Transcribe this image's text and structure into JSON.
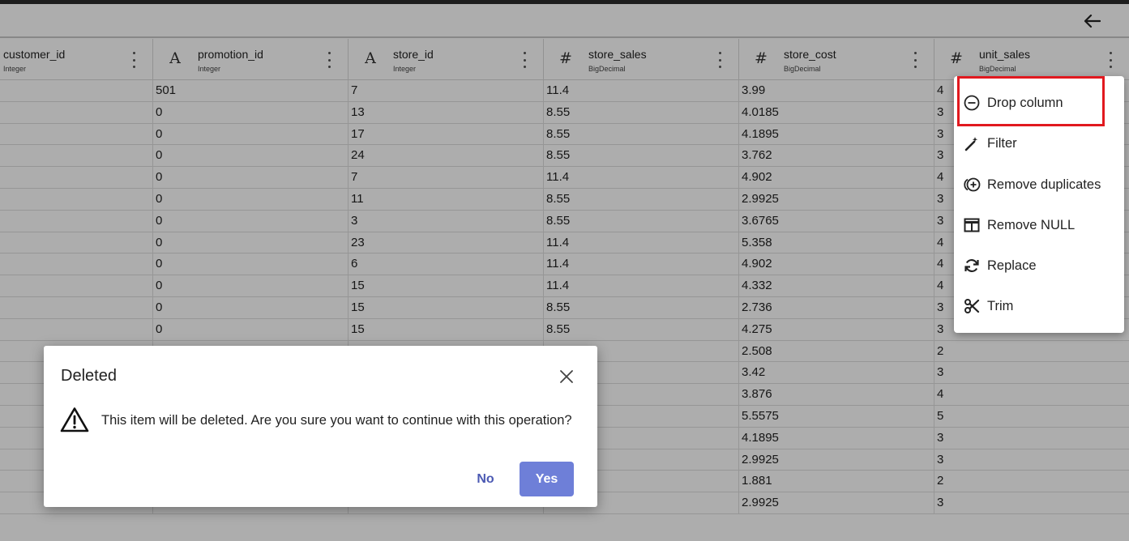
{
  "columns": [
    {
      "name": "customer_id",
      "type": "Integer",
      "icon": "text-type-icon",
      "glyph": ""
    },
    {
      "name": "promotion_id",
      "type": "Integer",
      "icon": "text-type-icon",
      "glyph": "A"
    },
    {
      "name": "store_id",
      "type": "Integer",
      "icon": "text-type-icon",
      "glyph": "A"
    },
    {
      "name": "store_sales",
      "type": "BigDecimal",
      "icon": "numeric-type-icon",
      "glyph": "#"
    },
    {
      "name": "store_cost",
      "type": "BigDecimal",
      "icon": "numeric-type-icon",
      "glyph": "#"
    },
    {
      "name": "unit_sales",
      "type": "BigDecimal",
      "icon": "numeric-type-icon",
      "glyph": "#"
    }
  ],
  "rows": [
    [
      "",
      "501",
      "7",
      "11.4",
      "3.99",
      "4"
    ],
    [
      "",
      "0",
      "13",
      "8.55",
      "4.0185",
      "3"
    ],
    [
      "",
      "0",
      "17",
      "8.55",
      "4.1895",
      "3"
    ],
    [
      "",
      "0",
      "24",
      "8.55",
      "3.762",
      "3"
    ],
    [
      "",
      "0",
      "7",
      "11.4",
      "4.902",
      "4"
    ],
    [
      "",
      "0",
      "11",
      "8.55",
      "2.9925",
      "3"
    ],
    [
      "",
      "0",
      "3",
      "8.55",
      "3.6765",
      "3"
    ],
    [
      "",
      "0",
      "23",
      "11.4",
      "5.358",
      "4"
    ],
    [
      "",
      "0",
      "6",
      "11.4",
      "4.902",
      "4"
    ],
    [
      "",
      "0",
      "15",
      "11.4",
      "4.332",
      "4"
    ],
    [
      "",
      "0",
      "15",
      "8.55",
      "2.736",
      "3"
    ],
    [
      "",
      "0",
      "15",
      "8.55",
      "4.275",
      "3"
    ],
    [
      "",
      "",
      "",
      "",
      "2.508",
      "2"
    ],
    [
      "",
      "",
      "",
      "",
      "3.42",
      "3"
    ],
    [
      "",
      "",
      "",
      "",
      "3.876",
      "4"
    ],
    [
      "",
      "",
      "",
      "",
      "5.5575",
      "5"
    ],
    [
      "",
      "",
      "",
      "",
      "4.1895",
      "3"
    ],
    [
      "",
      "",
      "",
      "",
      "2.9925",
      "3"
    ],
    [
      "",
      "",
      "",
      "",
      "1.881",
      "2"
    ],
    [
      "",
      "",
      "",
      "",
      "2.9925",
      "3"
    ]
  ],
  "column_menu": {
    "items": [
      {
        "label": "Drop column",
        "icon": "minus-circle-icon"
      },
      {
        "label": "Filter",
        "icon": "magic-wand-icon"
      },
      {
        "label": "Remove duplicates",
        "icon": "add-circle-duplicate-icon"
      },
      {
        "label": "Remove NULL",
        "icon": "table-columns-icon"
      },
      {
        "label": "Replace",
        "icon": "refresh-icon"
      },
      {
        "label": "Trim",
        "icon": "scissors-icon"
      }
    ],
    "highlight_color": "#e1191f"
  },
  "dialog": {
    "title": "Deleted",
    "message": "This item will be deleted. Are you sure you want to continue with this operation?",
    "no_label": "No",
    "yes_label": "Yes",
    "accent_color": "#6e7fd8"
  }
}
